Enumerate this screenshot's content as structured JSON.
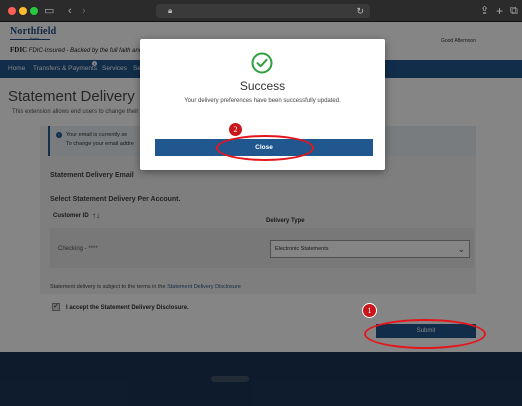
{
  "browser": {
    "back_icon": "chevron-left-icon",
    "forward_icon": "chevron-right-icon",
    "share_icon": "share-icon",
    "new_tab_icon": "plus-icon",
    "tabs_icon": "tabs-icon"
  },
  "header": {
    "logo": "Northfield",
    "logo_sub": "Bank",
    "fdic_mark": "FDIC",
    "fdic_text": "FDIC-Insured - Backed by the full faith and credit of th",
    "greeting": "Good Afternoon"
  },
  "nav": {
    "items": [
      "Home",
      "Transfers & Payments",
      "Services",
      "Se"
    ],
    "notification": "i"
  },
  "page": {
    "title": "Statement Delivery Prefe",
    "description": "This extension allows end users to change their",
    "info_line1": "Your email is currently se",
    "info_line2": "To change your email addre",
    "section_email": "Statement Delivery Email",
    "section_select": "Select Statement Delivery Per Account.",
    "col_customer_id": "Customer ID",
    "col_delivery_type": "Delivery Type",
    "account_label": "Checking - ****",
    "delivery_selected": "Electronic Statements",
    "terms_prefix": "Statement delivery is subject to the terms in the ",
    "terms_link": "Statement Delivery Disclosure",
    "checkbox_checked": true,
    "accept_label": "I accept the Statement Delivery Disclosure.",
    "submit_label": "Submit"
  },
  "modal": {
    "title": "Success",
    "message": "Your delivery preferences have been successfully updated.",
    "close_label": "Close",
    "icon": "check-circle-icon"
  },
  "annotations": {
    "badge_1": "1",
    "badge_2": "2"
  },
  "colors": {
    "brand_blue": "#21578f",
    "success_green": "#2e9e3e",
    "annotation_red": "#e5161b"
  }
}
